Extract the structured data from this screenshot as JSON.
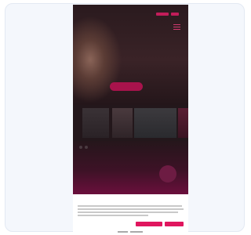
{
  "colors": {
    "accent": "#c21d5a",
    "consent_button": "#e0165e",
    "page_background": "#1b1014"
  },
  "icons": {
    "menu": "menu-icon",
    "chat": "chat-icon"
  },
  "header": {
    "brand": ""
  },
  "consent": {
    "title": ""
  }
}
